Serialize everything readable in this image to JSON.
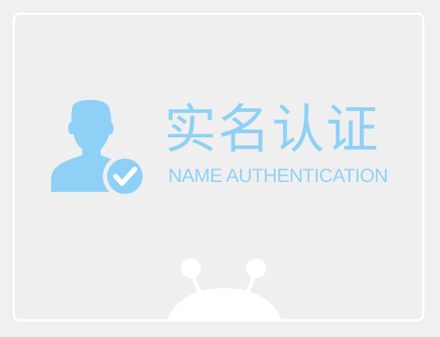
{
  "card": {
    "title_cn": "实名认证",
    "title_en": "NAME AUTHENTICATION"
  },
  "icons": {
    "user": "user-verified-icon",
    "mascot": "robot-mascot-icon"
  },
  "colors": {
    "accent": "#8fd1f6",
    "background": "#f0f0f0",
    "card_border": "#ffffff"
  }
}
